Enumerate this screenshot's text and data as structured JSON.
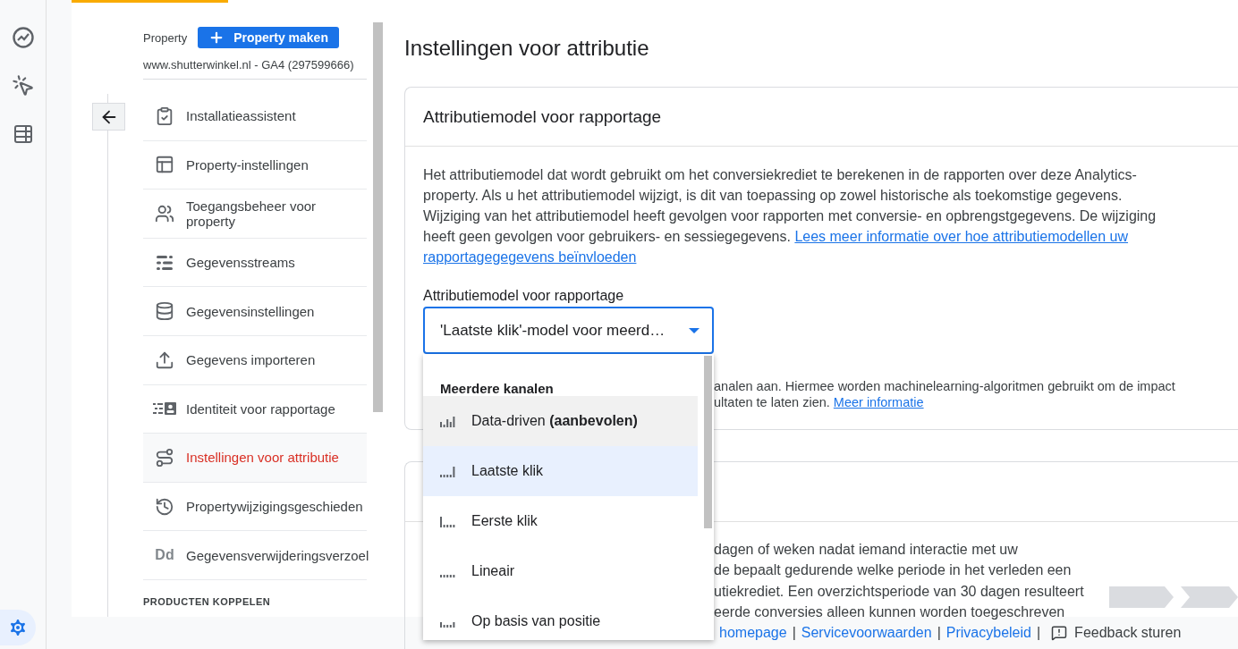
{
  "admin_panel": {
    "property_label": "Property",
    "create_button": "Property maken",
    "account": "www.shutterwinkel.nl - GA4 (297599666)",
    "nav_items": [
      {
        "label": "Installatieassistent",
        "selected": false
      },
      {
        "label": "Property-instellingen",
        "selected": false
      },
      {
        "label": "Toegangsbeheer voor property",
        "selected": false
      },
      {
        "label": "Gegevensstreams",
        "selected": false
      },
      {
        "label": "Gegevensinstellingen",
        "selected": false
      },
      {
        "label": "Gegevens importeren",
        "selected": false
      },
      {
        "label": "Identiteit voor rapportage",
        "selected": false
      },
      {
        "label": "Instellingen voor attributie",
        "selected": true
      },
      {
        "label": "Propertywijzigingsgeschieden",
        "selected": false
      },
      {
        "label": "Gegevensverwijderingsverzoel",
        "selected": false,
        "icon_text": "Dd"
      }
    ],
    "section_heading": "PRODUCTEN KOPPELEN"
  },
  "page_title": "Instellingen voor attributie",
  "card": {
    "title": "Attributiemodel voor rapportage",
    "description": "Het attributiemodel dat wordt gebruikt om het conversiekrediet te berekenen in de rapporten over deze Analytics-property. Als u het attributiemodel wijzigt, is dit van toepassing op zowel historische als toekomstige gegevens. Wijziging van het attributiemodel heeft gevolgen voor rapporten met conversie- en opbrengstgegevens. De wijziging heeft geen gevolgen voor gebruikers- en sessiegegevens.",
    "description_link": [
      "Lees meer informatie over hoe attributiemodellen uw",
      "rapportagegegevens beïnvloeden"
    ],
    "field_label": "Attributiemodel voor rapportage",
    "field_value": "'Laatste klik'-model voor meerd…",
    "hidden_text_lines": [
      "analen aan. Hiermee worden machinelearning-algoritmen gebruikt om de impact",
      "ultaten te laten zien."
    ],
    "hidden_text_link": "Meer informatie"
  },
  "dropdown": {
    "group": "Meerdere kanalen",
    "options": [
      {
        "label": "Data-driven **(aanbevolen)**",
        "selected": false,
        "hovered": true
      },
      {
        "label": "Laatste klik",
        "selected": true,
        "hovered": false
      },
      {
        "label": "Eerste klik",
        "selected": false,
        "hovered": false
      },
      {
        "label": "Lineair",
        "selected": false,
        "hovered": false
      },
      {
        "label": "Op basis van positie",
        "selected": false,
        "hovered": false
      }
    ]
  },
  "card2": {
    "text_lines": [
      "dagen of weken nadat iemand interactie met uw",
      "de bepaalt gedurende welke periode in het verleden een",
      "utiekrediet. Een overzichtsperiode van 30 dagen resulteert",
      "eerde conversies alleen kunnen worden toegeschreven"
    ]
  },
  "footer": {
    "links": [
      "homepage",
      "Servicevoorwaarden",
      "Privacybeleid"
    ],
    "separator": "|",
    "feedback": "Feedback sturen"
  }
}
